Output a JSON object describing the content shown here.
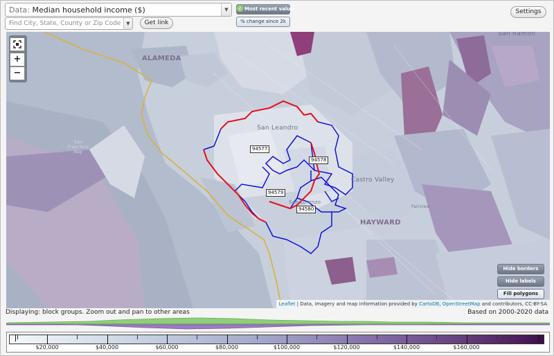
{
  "controls": {
    "data_prefix": "Data:",
    "data_value": "Median household income ($)",
    "search_placeholder": "Find City, State, County or Zip Code",
    "get_link_label": "Get link",
    "settings_label": "Settings",
    "toggle_recent_label": "Most recent value",
    "toggle_change_label": "% change since 2k",
    "dropdown_icon": "chevron-down-icon"
  },
  "map": {
    "zoom_extent_icon": "fullscreen-icon",
    "zoom_in_label": "+",
    "zoom_out_label": "−",
    "places": {
      "alameda": "ALAMEDA",
      "san_leandro": "San Leandro",
      "castro_valley": "Castro Valley",
      "hayward": "HAYWARD",
      "san_ramon": "San Ramon",
      "san_lorenzo": "San Lorenzo",
      "fairview": "Fairview",
      "sf_bay": "San Francisco Bay"
    },
    "zip_labels": {
      "z94577": "94577",
      "z94578": "94578",
      "z94579": "94579",
      "z94580": "94580"
    },
    "hide_borders_label": "Hide borders",
    "hide_labels_label": "Hide labels",
    "fill_polygons_label": "Fill polygons",
    "attribution": {
      "leaflet": "Leaflet",
      "sep": " | Data, imagery and map information provided by ",
      "carto": "CartoDB",
      "comma": ", ",
      "osm": "OpenStreetMap",
      "rest": " and contributors, CC-BY-SA"
    },
    "colors": {
      "zip_border": "#1010d8",
      "city_border": "#e8101a",
      "county_line": "#d8b23a"
    }
  },
  "footer": {
    "displaying": "Displaying: block groups. Zoom out and pan to other areas",
    "based_on": "Based on 2000-2020 data"
  },
  "legend": {
    "labels": [
      "$20,000",
      "$40,000",
      "$60,000",
      "$80,000",
      "$100,000",
      "$120,000",
      "$140,000",
      "$160,000"
    ]
  }
}
